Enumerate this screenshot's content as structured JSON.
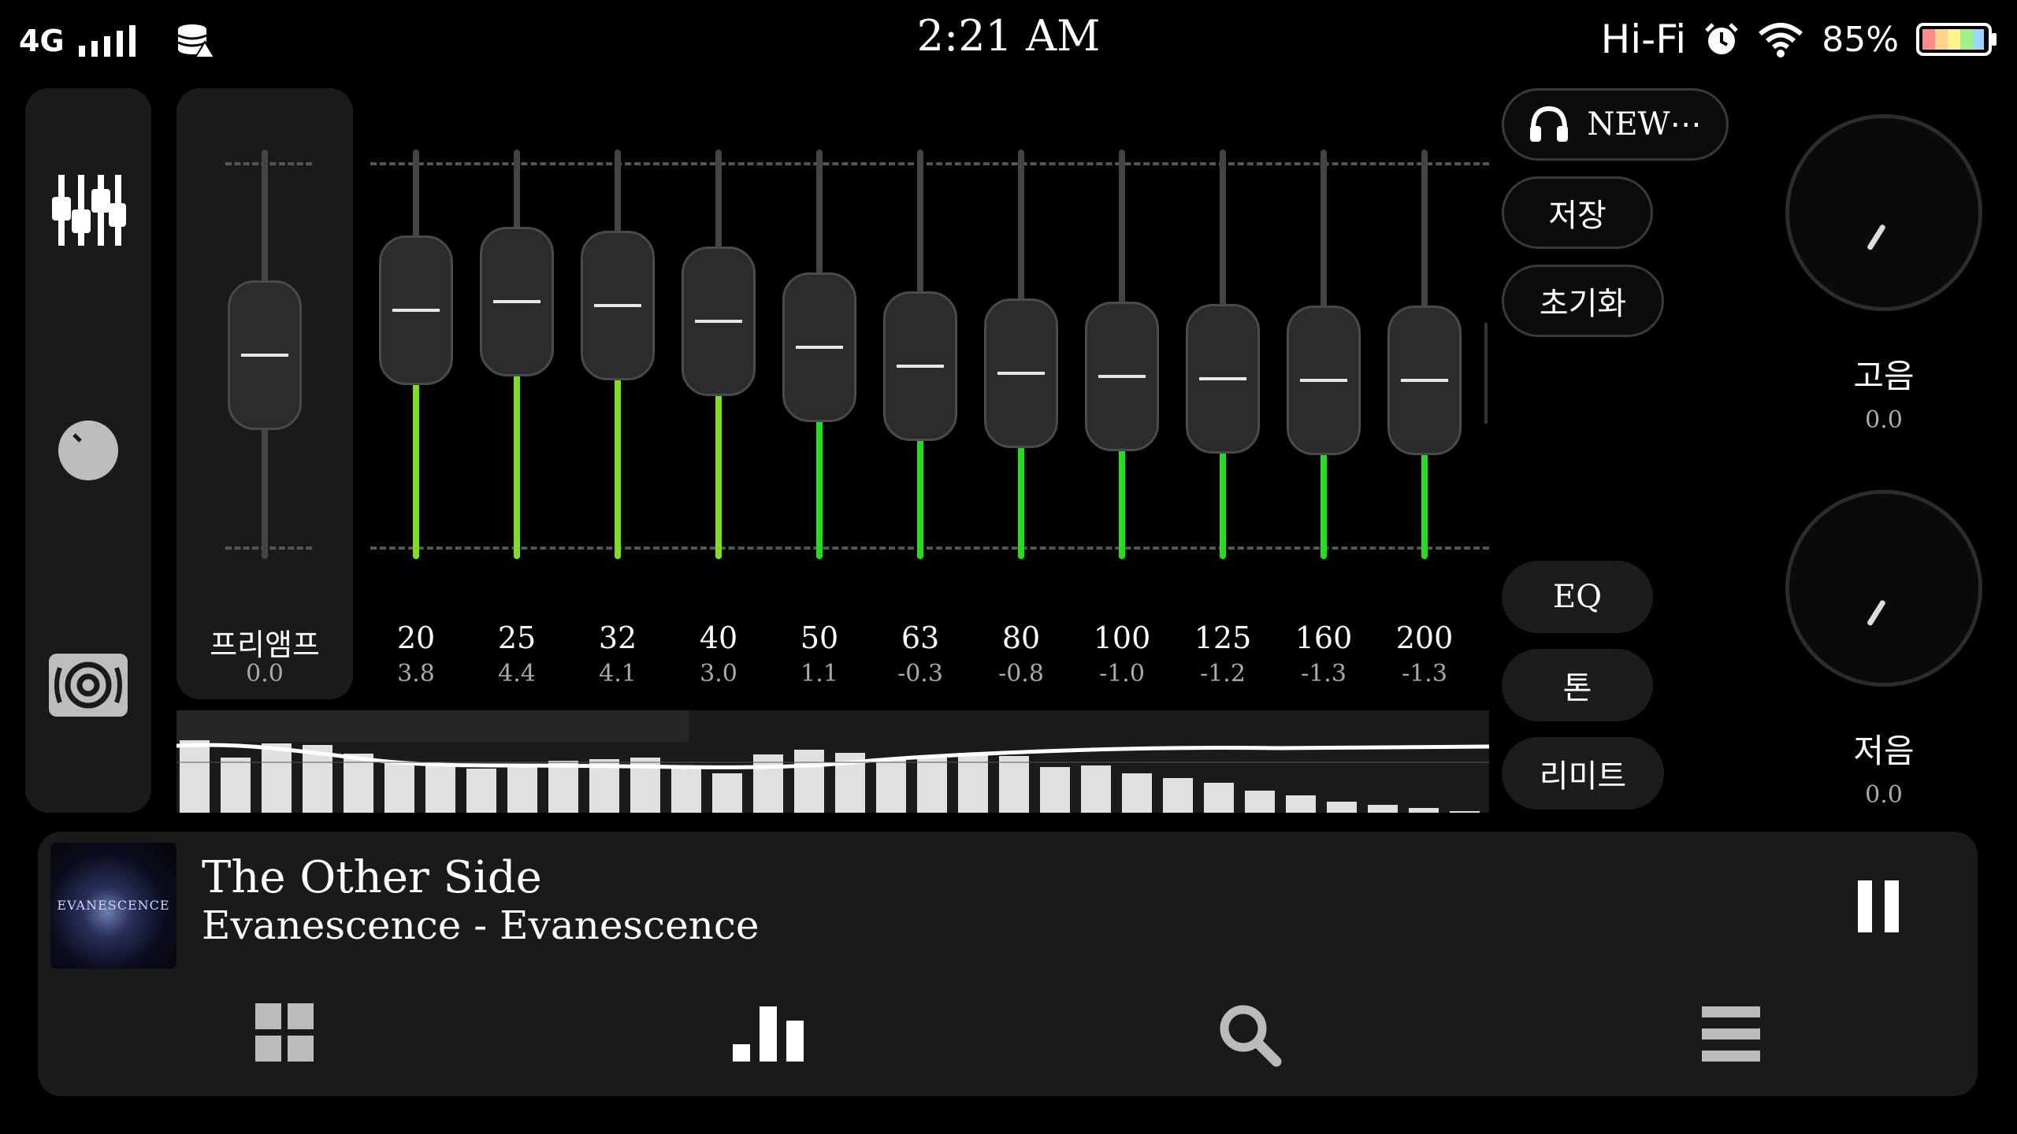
{
  "status_bar": {
    "network": "4G",
    "time": "2:21 AM",
    "hifi": "Hi-Fi",
    "battery_pct": "85%"
  },
  "rail": {
    "icons": [
      "equalizer-sliders-icon",
      "knob-icon",
      "speaker-icon"
    ]
  },
  "preamp": {
    "label": "프리앰프",
    "value": "0.0"
  },
  "bands": [
    {
      "freq": "20",
      "gain": "3.8"
    },
    {
      "freq": "25",
      "gain": "4.4"
    },
    {
      "freq": "32",
      "gain": "4.1"
    },
    {
      "freq": "40",
      "gain": "3.0"
    },
    {
      "freq": "50",
      "gain": "1.1"
    },
    {
      "freq": "63",
      "gain": "-0.3"
    },
    {
      "freq": "80",
      "gain": "-0.8"
    },
    {
      "freq": "100",
      "gain": "-1.0"
    },
    {
      "freq": "125",
      "gain": "-1.2"
    },
    {
      "freq": "160",
      "gain": "-1.3"
    },
    {
      "freq": "200",
      "gain": "-1.3"
    }
  ],
  "buttons": {
    "preset": "NEW⋯",
    "save": "저장",
    "reset": "초기화",
    "eq": "EQ",
    "tone": "톤",
    "limit": "리미트"
  },
  "dials": {
    "treble": {
      "label": "고음",
      "value": "0.0"
    },
    "bass": {
      "label": "저음",
      "value": "0.0"
    }
  },
  "now_playing": {
    "title": "The Other Side",
    "subtitle": "Evanescence - Evanescence",
    "art_text": "EVANESCENCE"
  },
  "colors": {
    "accent_green": "#22dd22",
    "accent_lime": "#7ddf1e",
    "panel": "#1a1a1a"
  }
}
